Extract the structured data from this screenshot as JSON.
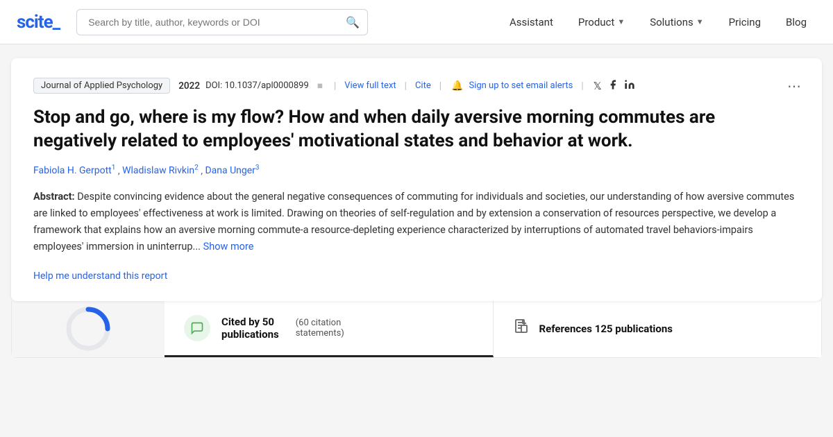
{
  "navbar": {
    "logo_text": "scite_",
    "search_placeholder": "Search by title, author, keywords or DOI",
    "nav_items": [
      {
        "label": "Assistant",
        "has_dropdown": false
      },
      {
        "label": "Product",
        "has_dropdown": true
      },
      {
        "label": "Solutions",
        "has_dropdown": true
      },
      {
        "label": "Pricing",
        "has_dropdown": false
      },
      {
        "label": "Blog",
        "has_dropdown": false
      }
    ]
  },
  "article": {
    "journal": "Journal of Applied Psychology",
    "year": "2022",
    "doi_label": "DOI:",
    "doi": "10.1037/apl0000899",
    "view_full_text": "View full text",
    "cite": "Cite",
    "sign_up_alert": "Sign up to set email alerts",
    "title": "Stop and go, where is my flow? How and when daily aversive morning commutes are negatively related to employees' motivational states and behavior at work.",
    "authors": [
      {
        "name": "Fabiola H. Gerpott",
        "sup": "1"
      },
      {
        "name": "Wladislaw Rivkin",
        "sup": "2"
      },
      {
        "name": "Dana Unger",
        "sup": "3"
      }
    ],
    "abstract_label": "Abstract:",
    "abstract_text": "Despite convincing evidence about the general negative consequences of commuting for individuals and societies, our understanding of how aversive commutes are linked to employees' effectiveness at work is limited. Drawing on theories of self-regulation and by extension a conservation of resources perspective, we develop a framework that explains how an aversive morning commute-a resource-depleting experience characterized by interruptions of automated travel behaviors-impairs employees' immersion in uninterrup...",
    "show_more": "Show more",
    "help_link": "Help me understand this report"
  },
  "stats": {
    "cited_by_label": "Cited by 50",
    "cited_by_sub": "publications",
    "citation_count": "(60 citation",
    "citation_count_sub": "statements)",
    "references_label": "References 125 publications"
  }
}
